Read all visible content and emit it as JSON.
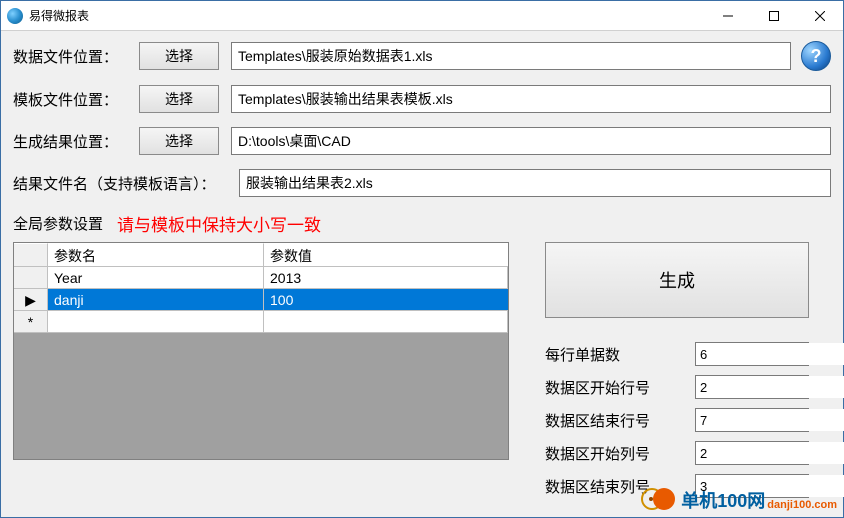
{
  "titlebar": {
    "title": "易得微报表"
  },
  "rows": {
    "dataFile": {
      "label": "数据文件位置：",
      "choose": "选择",
      "value": "Templates\\服装原始数据表1.xls"
    },
    "tplFile": {
      "label": "模板文件位置：",
      "choose": "选择",
      "value": "Templates\\服装输出结果表模板.xls"
    },
    "outPath": {
      "label": "生成结果位置：",
      "choose": "选择",
      "value": "D:\\tools\\桌面\\CAD"
    },
    "outName": {
      "label": "结果文件名（支持模板语言）：",
      "value": "服装输出结果表2.xls"
    }
  },
  "globalParam": {
    "label": "全局参数设置",
    "warning": "请与模板中保持大小写一致"
  },
  "table": {
    "headers": {
      "name": "参数名",
      "value": "参数值"
    },
    "rows": [
      {
        "marker": "",
        "name": "Year",
        "value": "2013",
        "selected": false
      },
      {
        "marker": "▶",
        "name": "danji",
        "value": "100",
        "selected": true
      },
      {
        "marker": "*",
        "name": "",
        "value": "",
        "selected": false
      }
    ]
  },
  "generate": {
    "label": "生成"
  },
  "params": [
    {
      "label": "每行单据数",
      "value": "6"
    },
    {
      "label": "数据区开始行号",
      "value": "2"
    },
    {
      "label": "数据区结束行号",
      "value": "7"
    },
    {
      "label": "数据区开始列号",
      "value": "2"
    },
    {
      "label": "数据区结束列号",
      "value": "3"
    }
  ],
  "watermark": {
    "text1": "单机100网",
    "text2": "danji100.com"
  }
}
